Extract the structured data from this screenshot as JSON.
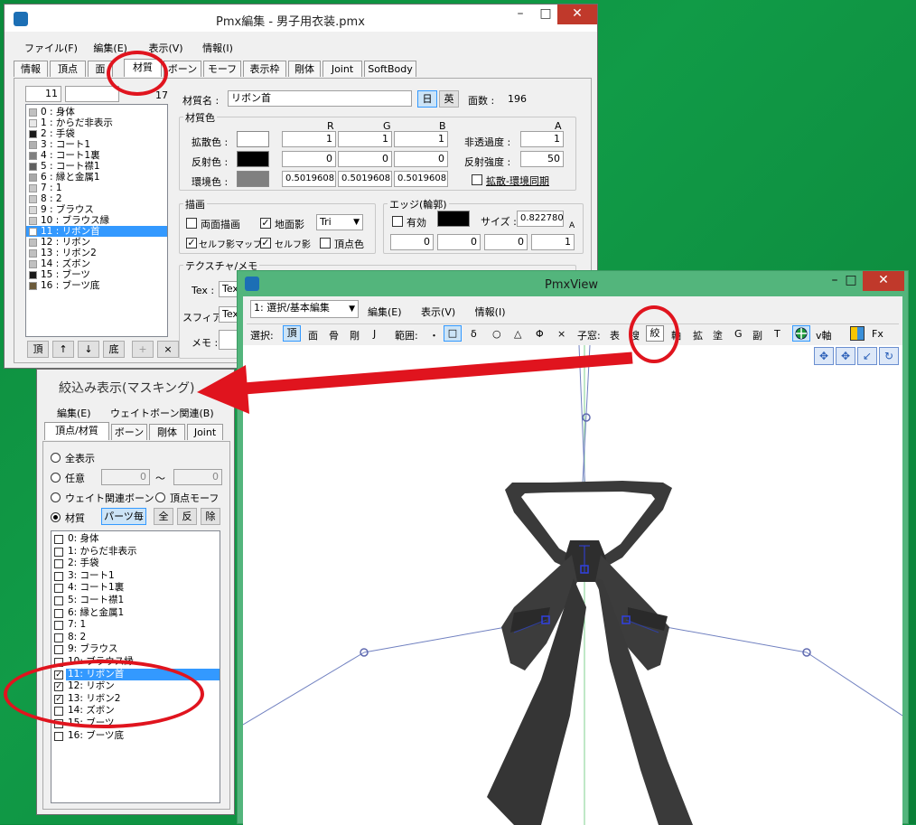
{
  "pmx_editor": {
    "title": "Pmx編集 - 男子用衣装.pmx",
    "menu": [
      "ファイル(F)",
      "編集(E)",
      "表示(V)",
      "情報(I)"
    ],
    "tabs": [
      "情報",
      "頂点",
      "面",
      "材質",
      "ボーン",
      "モーフ",
      "表示枠",
      "剛体",
      "Joint",
      "SoftBody"
    ],
    "index_value": "11",
    "count_value": "17",
    "materials": [
      {
        "label": "0 : 身体",
        "color": "#c0c0c0"
      },
      {
        "label": "1 : からだ非表示",
        "color": "#e8e8e8"
      },
      {
        "label": "2 : 手袋",
        "color": "#1a1a1a"
      },
      {
        "label": "3 : コート1",
        "color": "#b0b0b0"
      },
      {
        "label": "4 : コート1裏",
        "color": "#808080"
      },
      {
        "label": "5 : コート襟1",
        "color": "#606060"
      },
      {
        "label": "6 : 縁と金属1",
        "color": "#a8a8a8"
      },
      {
        "label": "7 : 1",
        "color": "#c8c8c8"
      },
      {
        "label": "8 : 2",
        "color": "#c8c8c8"
      },
      {
        "label": "9 : ブラウス",
        "color": "#d8d8d8"
      },
      {
        "label": "10 : ブラウス縁",
        "color": "#c8c8c8"
      },
      {
        "label": "11 : リボン首",
        "color": "#ffffff"
      },
      {
        "label": "12 : リボン",
        "color": "#c0c0c0"
      },
      {
        "label": "13 : リボン2",
        "color": "#c0c0c0"
      },
      {
        "label": "14 : ズボン",
        "color": "#c0c0c0"
      },
      {
        "label": "15 : ブーツ",
        "color": "#1a1a1a"
      },
      {
        "label": "16 : ブーツ底",
        "color": "#6b5a3a"
      }
    ],
    "list_buttons": [
      "頂",
      "↑",
      "↓",
      "底",
      "+",
      "×"
    ],
    "material_name_label": "材質名 :",
    "material_name": "リボン首",
    "lang_jp": "日",
    "lang_en": "英",
    "face_count_label": "面数 :",
    "face_count": "196",
    "material_color_label": "材質色",
    "rgb_headers": [
      "R",
      "G",
      "B"
    ],
    "alpha_header": "A",
    "diffuse_label": "拡散色 :",
    "diffuse": [
      "1",
      "1",
      "1"
    ],
    "specular_label": "反射色 :",
    "specular": [
      "0",
      "0",
      "0"
    ],
    "ambient_label": "環境色 :",
    "ambient": [
      "0.5019608",
      "0.5019608",
      "0.5019608"
    ],
    "opacity_label": "非透過度 :",
    "opacity": "1",
    "spec_power_label": "反射強度 :",
    "spec_power": "50",
    "sync_label": "拡散-環境同期",
    "draw_label": "描画",
    "double_side": "両面描画",
    "ground_shadow": "地面影",
    "draw_mode": "Tri",
    "self_shadow_map": "セルフ影マップ",
    "self_shadow": "セルフ影",
    "vertex_color": "頂点色",
    "edge_label": "エッジ(輪郭)",
    "edge_enabled": "有効",
    "size_label": "サイズ :",
    "edge_size": "0.822780",
    "edge_rgba": [
      "0",
      "0",
      "0",
      "1"
    ],
    "texture_label": "テクスチャ/メモ",
    "tex_label": "Tex :",
    "tex_value": "Tex",
    "sphere_label": "スフィア :",
    "sphere_value": "Tex",
    "memo_label": "メモ :"
  },
  "mask": {
    "title": "絞込み表示(マスキング)",
    "menu": [
      "編集(E)",
      "ウェイトボーン関連(B)"
    ],
    "tabs": [
      "頂点/材質",
      "ボーン",
      "剛体",
      "Joint"
    ],
    "all": "全表示",
    "any": "任意",
    "any_from": "0",
    "tilde": "〜",
    "any_to": "0",
    "weight_bone": "ウェイト関連ボーン",
    "vertex_morph": "頂点モーフ",
    "material": "材質",
    "per_part": "パーツ毎",
    "btn_all": "全",
    "btn_inv": "反",
    "btn_rem": "除",
    "items": [
      {
        "label": "0: 身体",
        "checked": false
      },
      {
        "label": "1: からだ非表示",
        "checked": false
      },
      {
        "label": "2: 手袋",
        "checked": false
      },
      {
        "label": "3: コート1",
        "checked": false
      },
      {
        "label": "4: コート1裏",
        "checked": false
      },
      {
        "label": "5: コート襟1",
        "checked": false
      },
      {
        "label": "6: 縁と金属1",
        "checked": false
      },
      {
        "label": "7: 1",
        "checked": false
      },
      {
        "label": "8: 2",
        "checked": false
      },
      {
        "label": "9: ブラウス",
        "checked": false
      },
      {
        "label": "10: ブラウス縁",
        "checked": false
      },
      {
        "label": "11: リボン首",
        "checked": true
      },
      {
        "label": "12: リボン",
        "checked": true
      },
      {
        "label": "13: リボン2",
        "checked": true
      },
      {
        "label": "14: ズボン",
        "checked": false
      },
      {
        "label": "15: ブーツ",
        "checked": false
      },
      {
        "label": "16: ブーツ底",
        "checked": false
      }
    ]
  },
  "pmxview": {
    "title": "PmxView",
    "mode": "1: 選択/基本編集",
    "menu": [
      "編集(E)",
      "表示(V)",
      "情報(I)"
    ],
    "select_label": "選択:",
    "select_items": [
      "頂",
      "面",
      "骨",
      "剛",
      "J"
    ],
    "range_label": "範囲:",
    "range_items": [
      "・",
      "□",
      "δ",
      "○",
      "△",
      "Φ",
      "×"
    ],
    "sub_label": "子窓:",
    "sub_items": [
      "表",
      "搜",
      "絞",
      "軸",
      "拡",
      "塗",
      "G",
      "副",
      "T"
    ],
    "vaxis": "v軸",
    "fx": "Fx"
  },
  "colors": {
    "accent": "#e0141e",
    "select": "#3399ff",
    "window_border": "#4fb07a"
  }
}
